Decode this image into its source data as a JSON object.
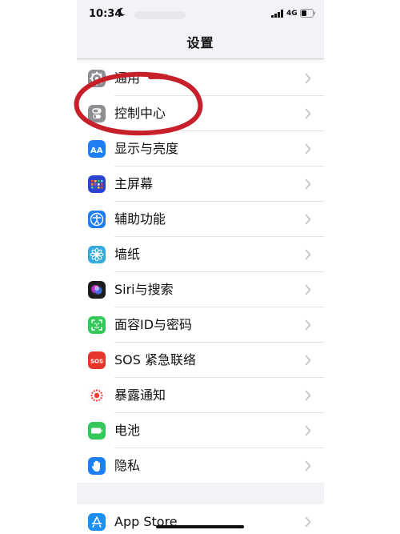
{
  "status_bar": {
    "time": "10:34",
    "network": "4G"
  },
  "nav": {
    "title": "设置"
  },
  "group1": [
    {
      "label": "通用",
      "icon": "gear-icon",
      "color": "#8e8e93"
    },
    {
      "label": "控制中心",
      "icon": "toggles-icon",
      "color": "#8e8e93"
    },
    {
      "label": "显示与亮度",
      "icon": "text-size-icon",
      "color": "#1d7ff2"
    },
    {
      "label": "主屏幕",
      "icon": "app-grid-icon",
      "color": "#2c44d4"
    },
    {
      "label": "辅助功能",
      "icon": "accessibility-icon",
      "color": "#1d7ff2"
    },
    {
      "label": "墙纸",
      "icon": "flower-icon",
      "color": "#35aadc"
    },
    {
      "label": "Siri与搜索",
      "icon": "siri-icon",
      "color": "#1c1c1e"
    },
    {
      "label": "面容ID与密码",
      "icon": "face-id-icon",
      "color": "#34c759"
    },
    {
      "label": "SOS 紧急联络",
      "icon": "sos-icon",
      "color": "#e8362d",
      "icon_text": "SOS"
    },
    {
      "label": "暴露通知",
      "icon": "exposure-icon",
      "color": "#ffffff"
    },
    {
      "label": "电池",
      "icon": "battery-icon",
      "color": "#34c759"
    },
    {
      "label": "隐私",
      "icon": "hand-icon",
      "color": "#1d7ff2"
    }
  ],
  "group2": [
    {
      "label": "App Store",
      "icon": "app-store-icon",
      "color": "#1d8ef2"
    }
  ],
  "colors": {
    "background": "#f2f2f7",
    "annotation": "#c7202a"
  }
}
